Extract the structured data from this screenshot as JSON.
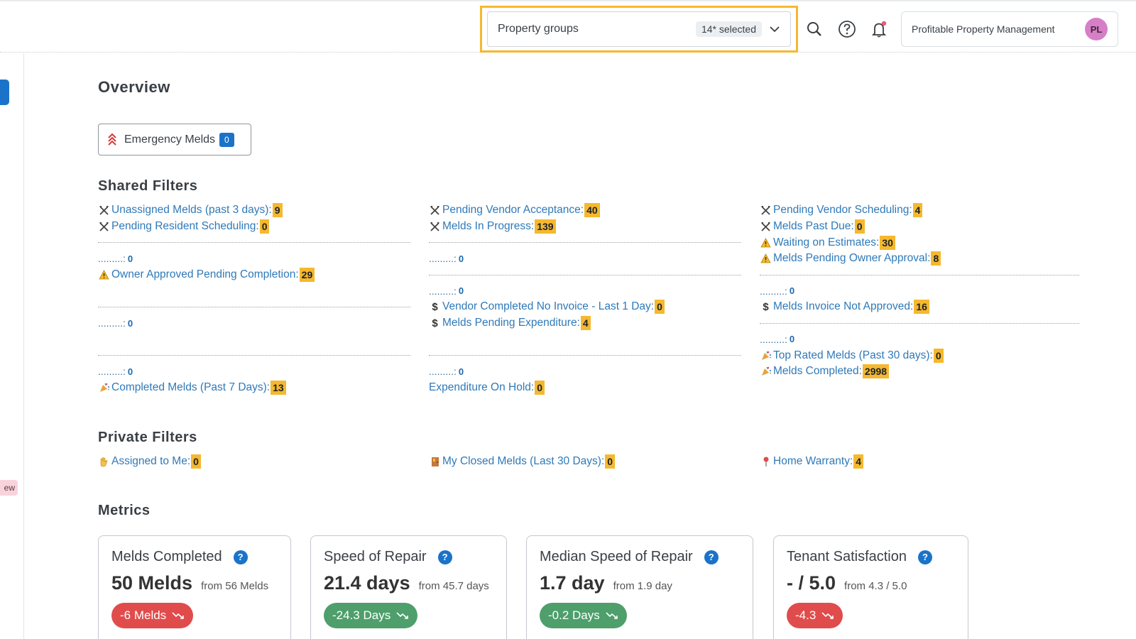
{
  "header": {
    "property_groups_label": "Property groups",
    "selected_badge": "14* selected",
    "org_name": "Profitable Property Management",
    "avatar_initials": "PL"
  },
  "sidebar": {
    "new_badge": "ew"
  },
  "overview": {
    "title": "Overview",
    "emergency_label": "Emergency Melds",
    "emergency_count": "0"
  },
  "shared": {
    "title": "Shared Filters",
    "col1": {
      "unassigned": {
        "label": "Unassigned Melds (past 3 days):",
        "count": "9"
      },
      "pending_resident": {
        "label": "Pending Resident Scheduling:",
        "count": "0"
      },
      "dots1": {
        "label": ".........:",
        "count": "0"
      },
      "owner_approved": {
        "label": "Owner Approved Pending Completion:",
        "count": "29"
      },
      "dots2": {
        "label": ".........:",
        "count": "0"
      },
      "dots3": {
        "label": ".........:",
        "count": "0"
      },
      "completed7": {
        "label": "Completed Melds (Past 7 Days):",
        "count": "13"
      }
    },
    "col2": {
      "pending_vendor_accept": {
        "label": "Pending Vendor Acceptance:",
        "count": "40"
      },
      "in_progress": {
        "label": "Melds In Progress:",
        "count": "139"
      },
      "dots1": {
        "label": ".........:",
        "count": "0"
      },
      "dots2": {
        "label": ".........:",
        "count": "0"
      },
      "vendor_no_invoice": {
        "label": "Vendor Completed No Invoice - Last 1 Day:",
        "count": "0"
      },
      "pending_expenditure": {
        "label": "Melds Pending Expenditure:",
        "count": "4"
      },
      "dots3": {
        "label": ".........:",
        "count": "0"
      },
      "expenditure_hold": {
        "label": "Expenditure On Hold:",
        "count": "0"
      }
    },
    "col3": {
      "pending_vendor_sched": {
        "label": "Pending Vendor Scheduling:",
        "count": "4"
      },
      "past_due": {
        "label": "Melds Past Due:",
        "count": "0"
      },
      "waiting_estimates": {
        "label": "Waiting on Estimates:",
        "count": "30"
      },
      "pending_owner": {
        "label": "Melds Pending Owner Approval:",
        "count": "8"
      },
      "dots1": {
        "label": ".........:",
        "count": "0"
      },
      "invoice_not_approved": {
        "label": "Melds Invoice Not Approved:",
        "count": "16"
      },
      "dots2": {
        "label": ".........:",
        "count": "0"
      },
      "top_rated": {
        "label": "Top Rated Melds (Past 30 days):",
        "count": "0"
      },
      "completed": {
        "label": "Melds Completed:",
        "count": "2998"
      }
    }
  },
  "private": {
    "title": "Private Filters",
    "assigned": {
      "label": "Assigned to Me:",
      "count": "0"
    },
    "closed30": {
      "label": "My Closed Melds (Last 30 Days):",
      "count": "0"
    },
    "warranty": {
      "label": "Home Warranty:",
      "count": "4"
    }
  },
  "metrics": {
    "title": "Metrics",
    "cards": [
      {
        "title": "Melds Completed",
        "value": "50 Melds",
        "from": "from 56 Melds",
        "delta": "-6 Melds",
        "trend": "down",
        "color": "#e04c4c"
      },
      {
        "title": "Speed of Repair",
        "value": "21.4 days",
        "from": "from 45.7 days",
        "delta": "-24.3 Days",
        "trend": "down",
        "color": "#4e9f6b"
      },
      {
        "title": "Median Speed of Repair",
        "value": "1.7 day",
        "from": "from 1.9 day",
        "delta": "-0.2 Days",
        "trend": "down",
        "color": "#4e9f6b"
      },
      {
        "title": "Tenant Satisfaction",
        "value": "- / 5.0",
        "from": "from 4.3 / 5.0",
        "delta": "-4.3",
        "trend": "down",
        "color": "#e04c4c"
      }
    ]
  },
  "colors": {
    "accent": "#1b73c9",
    "highlight": "#f5b82e",
    "link": "#2f79b8"
  }
}
